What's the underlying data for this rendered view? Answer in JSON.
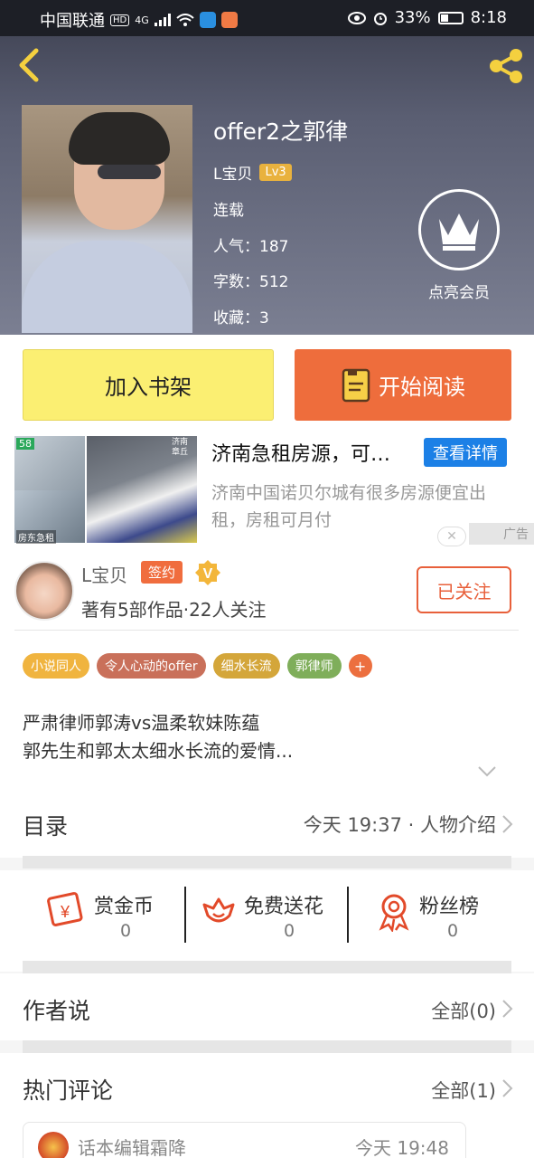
{
  "status_bar": {
    "carrier": "中国联通",
    "hd": "HD",
    "network": "4G",
    "battery_pct": "33%",
    "time": "8:18"
  },
  "book": {
    "title": "offer2之郭律",
    "author": "L宝贝",
    "level": "Lv3",
    "status": "连载",
    "popularity_label": "人气：",
    "popularity": "187",
    "words_label": "字数：",
    "words": "512",
    "favorites_label": "收藏：",
    "favorites": "3",
    "vip_label": "点亮会员"
  },
  "actions": {
    "add_shelf": "加入书架",
    "start_read": "开始阅读"
  },
  "ad": {
    "logo": "58",
    "img_tag": "房东急租",
    "location_tag": "济南\n章丘",
    "title": "济南急租房源，可…",
    "cta": "查看详情",
    "desc": "济南中国诺贝尔城有很多房源便宜出租，房租可月付",
    "mark": "广告"
  },
  "author_box": {
    "name": "L宝贝",
    "sign_badge": "签约",
    "works": "著有5部作品·22人关注",
    "follow": "已关注"
  },
  "tags": [
    {
      "label": "小说同人",
      "color": "#f0b43f"
    },
    {
      "label": "令人心动的offer",
      "color": "#c9705a"
    },
    {
      "label": "细水长流",
      "color": "#d4a63a"
    },
    {
      "label": "郭律师",
      "color": "#7fae5a"
    }
  ],
  "tag_more": "+",
  "intro": {
    "line1": "严肃律师郭涛vs温柔软妹陈蕴",
    "line2": "郭先生和郭太太细水长流的爱情..."
  },
  "toc": {
    "title": "目录",
    "latest": "今天 19:37 · 人物介绍"
  },
  "gifts": [
    {
      "title": "赏金币",
      "count": "0",
      "icon": "coin-icon"
    },
    {
      "title": "免费送花",
      "count": "0",
      "icon": "flower-icon"
    },
    {
      "title": "粉丝榜",
      "count": "0",
      "icon": "medal-icon"
    }
  ],
  "author_says": {
    "title": "作者说",
    "all": "全部(0)"
  },
  "hot_comments": {
    "title": "热门评论",
    "all": "全部(1)",
    "first": {
      "user": "话本编辑霜降",
      "time": "今天 19:48"
    }
  },
  "colors": {
    "accent": "#ee6d3c",
    "shelf_yellow": "#fbef72",
    "link_blue": "#1c80e6"
  }
}
